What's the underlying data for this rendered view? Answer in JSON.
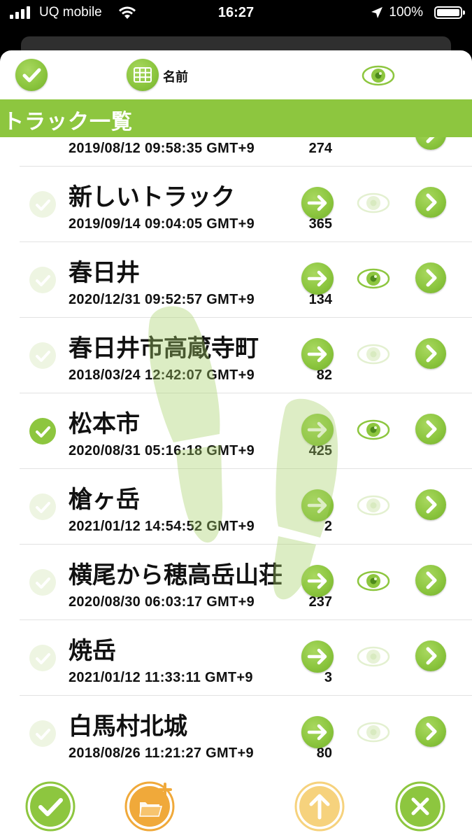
{
  "status_bar": {
    "carrier": "UQ mobile",
    "time": "16:27",
    "battery": "100%",
    "signal_icon": "cellular-signal-icon",
    "wifi_icon": "wifi-icon",
    "location_icon": "location-arrow-icon",
    "battery_icon": "battery-icon"
  },
  "toolbar": {
    "select_all_icon": "check-circle-icon",
    "sort_icon": "grid-sort-icon",
    "sort_label": "名前",
    "visibility_icon": "eye-icon"
  },
  "header": {
    "title": "トラック一覧"
  },
  "colors": {
    "accent": "#8dc63f",
    "folder": "#f0a93a",
    "upload": "#f6d27d"
  },
  "partial_row": {
    "date": "2019/08/12 09:58:35 GMT+9",
    "count": "274"
  },
  "tracks": [
    {
      "name": "新しいトラック",
      "date": "2019/09/14 09:04:05 GMT+9",
      "count": "365",
      "checked": false,
      "visible": false
    },
    {
      "name": "春日井",
      "date": "2020/12/31 09:52:57 GMT+9",
      "count": "134",
      "checked": false,
      "visible": true
    },
    {
      "name": "春日井市高蔵寺町",
      "date": "2018/03/24 12:42:07 GMT+9",
      "count": "82",
      "checked": false,
      "visible": false
    },
    {
      "name": "松本市",
      "date": "2020/08/31 05:16:18 GMT+9",
      "count": "425",
      "checked": true,
      "visible": true
    },
    {
      "name": "槍ヶ岳",
      "date": "2021/01/12 14:54:52 GMT+9",
      "count": "2",
      "checked": false,
      "visible": false
    },
    {
      "name": "横尾から穂高岳山荘",
      "date": "2020/08/30 06:03:17 GMT+9",
      "count": "237",
      "checked": false,
      "visible": true
    },
    {
      "name": "焼岳",
      "date": "2021/01/12 11:33:11 GMT+9",
      "count": "3",
      "checked": false,
      "visible": false
    },
    {
      "name": "白馬村北城",
      "date": "2018/08/26 11:21:27 GMT+9",
      "count": "80",
      "checked": false,
      "visible": false
    }
  ],
  "bottom_bar": {
    "confirm_icon": "check-icon",
    "add_folder_icon": "folder-add-icon",
    "upload_icon": "upload-arrow-icon",
    "close_icon": "close-icon"
  }
}
